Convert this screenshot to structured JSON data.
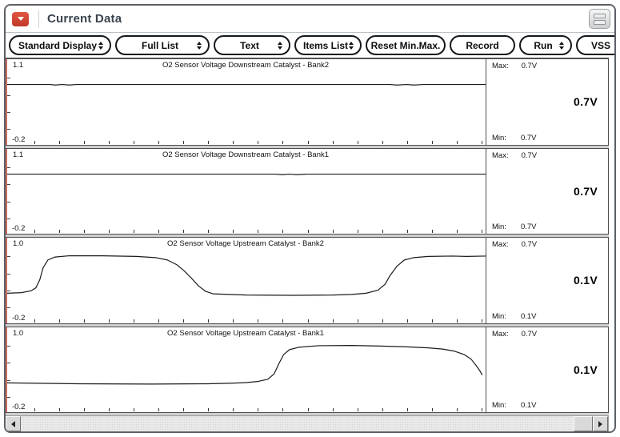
{
  "window": {
    "title": "Current Data"
  },
  "icons": {
    "menu_button": "red-down-triangle",
    "view_toggle": "stacked-bars",
    "dropdown_buttons": "up-down-arrows",
    "scroll_left": "left-arrow",
    "scroll_right": "right-arrow"
  },
  "colors": {
    "accent_red": "#d24a33",
    "row_accent": "#cc6a61",
    "trace": "#1a1a1a",
    "title_text": "#3a444e"
  },
  "toolbar": {
    "buttons": [
      {
        "label": "Standard Display",
        "dropdown": true
      },
      {
        "label": "Full List",
        "dropdown": true
      },
      {
        "label": "Text",
        "dropdown": true
      },
      {
        "label": "Items List",
        "dropdown": true
      },
      {
        "label": "Reset Min.Max.",
        "dropdown": false
      },
      {
        "label": "Record",
        "dropdown": false
      },
      {
        "label": "Run",
        "dropdown": true
      },
      {
        "label": "VSS",
        "dropdown": false
      }
    ]
  },
  "chart_data": [
    {
      "type": "line",
      "title": "O2 Sensor Voltage Downstream Catalyst - Bank2",
      "ylim": [
        -0.2,
        1.1
      ],
      "y_top_label": "1.1",
      "y_bottom_label": "-0.2",
      "max_label": "Max:",
      "max_value": "0.7V",
      "min_label": "Min:",
      "min_value": "0.7V",
      "current_value": "0.7V",
      "points": [
        [
          0,
          0.7
        ],
        [
          0.09,
          0.7
        ],
        [
          0.1,
          0.69
        ],
        [
          0.115,
          0.7
        ],
        [
          0.13,
          0.69
        ],
        [
          0.145,
          0.7
        ],
        [
          0.8,
          0.7
        ],
        [
          0.815,
          0.69
        ],
        [
          0.835,
          0.7
        ],
        [
          0.85,
          0.69
        ],
        [
          0.87,
          0.7
        ],
        [
          1,
          0.7
        ]
      ]
    },
    {
      "type": "line",
      "title": "O2 Sensor Voltage Downstream Catalyst - Bank1",
      "ylim": [
        -0.2,
        1.1
      ],
      "y_top_label": "1.1",
      "y_bottom_label": "-0.2",
      "max_label": "Max:",
      "max_value": "0.7V",
      "min_label": "Min:",
      "min_value": "0.7V",
      "current_value": "0.7V",
      "points": [
        [
          0,
          0.7
        ],
        [
          0.56,
          0.7
        ],
        [
          0.575,
          0.69
        ],
        [
          0.59,
          0.7
        ],
        [
          0.605,
          0.69
        ],
        [
          0.625,
          0.7
        ],
        [
          1,
          0.7
        ]
      ]
    },
    {
      "type": "line",
      "title": "O2 Sensor Voltage Upstream Catalyst - Bank2",
      "ylim": [
        -0.2,
        1.0
      ],
      "y_top_label": "1.0",
      "y_bottom_label": "-0.2",
      "max_label": "Max:",
      "max_value": "0.7V",
      "min_label": "Min:",
      "min_value": "0.1V",
      "current_value": "0.1V",
      "points": [
        [
          0,
          0.13
        ],
        [
          0.03,
          0.14
        ],
        [
          0.05,
          0.17
        ],
        [
          0.06,
          0.22
        ],
        [
          0.068,
          0.35
        ],
        [
          0.075,
          0.55
        ],
        [
          0.085,
          0.68
        ],
        [
          0.1,
          0.73
        ],
        [
          0.13,
          0.75
        ],
        [
          0.2,
          0.75
        ],
        [
          0.27,
          0.74
        ],
        [
          0.31,
          0.72
        ],
        [
          0.335,
          0.68
        ],
        [
          0.355,
          0.6
        ],
        [
          0.37,
          0.5
        ],
        [
          0.385,
          0.38
        ],
        [
          0.4,
          0.25
        ],
        [
          0.415,
          0.16
        ],
        [
          0.43,
          0.12
        ],
        [
          0.5,
          0.1
        ],
        [
          0.6,
          0.095
        ],
        [
          0.68,
          0.1
        ],
        [
          0.72,
          0.11
        ],
        [
          0.75,
          0.13
        ],
        [
          0.775,
          0.18
        ],
        [
          0.79,
          0.28
        ],
        [
          0.8,
          0.42
        ],
        [
          0.815,
          0.58
        ],
        [
          0.83,
          0.68
        ],
        [
          0.85,
          0.72
        ],
        [
          0.88,
          0.74
        ],
        [
          0.93,
          0.745
        ],
        [
          0.96,
          0.74
        ],
        [
          1,
          0.745
        ]
      ]
    },
    {
      "type": "line",
      "title": "O2 Sensor Voltage Upstream Catalyst - Bank1",
      "ylim": [
        -0.2,
        1.0
      ],
      "y_top_label": "1.0",
      "y_bottom_label": "-0.2",
      "max_label": "Max:",
      "max_value": "0.7V",
      "min_label": "Min:",
      "min_value": "0.1V",
      "current_value": "0.1V",
      "points": [
        [
          0,
          0.13
        ],
        [
          0.05,
          0.125
        ],
        [
          0.15,
          0.115
        ],
        [
          0.3,
          0.11
        ],
        [
          0.42,
          0.115
        ],
        [
          0.47,
          0.125
        ],
        [
          0.5,
          0.135
        ],
        [
          0.525,
          0.155
        ],
        [
          0.545,
          0.19
        ],
        [
          0.558,
          0.28
        ],
        [
          0.568,
          0.45
        ],
        [
          0.578,
          0.6
        ],
        [
          0.59,
          0.68
        ],
        [
          0.61,
          0.72
        ],
        [
          0.65,
          0.745
        ],
        [
          0.72,
          0.75
        ],
        [
          0.78,
          0.74
        ],
        [
          0.84,
          0.725
        ],
        [
          0.88,
          0.71
        ],
        [
          0.91,
          0.69
        ],
        [
          0.935,
          0.655
        ],
        [
          0.955,
          0.6
        ],
        [
          0.97,
          0.52
        ],
        [
          0.98,
          0.42
        ],
        [
          0.988,
          0.33
        ],
        [
          0.993,
          0.26
        ]
      ]
    }
  ]
}
